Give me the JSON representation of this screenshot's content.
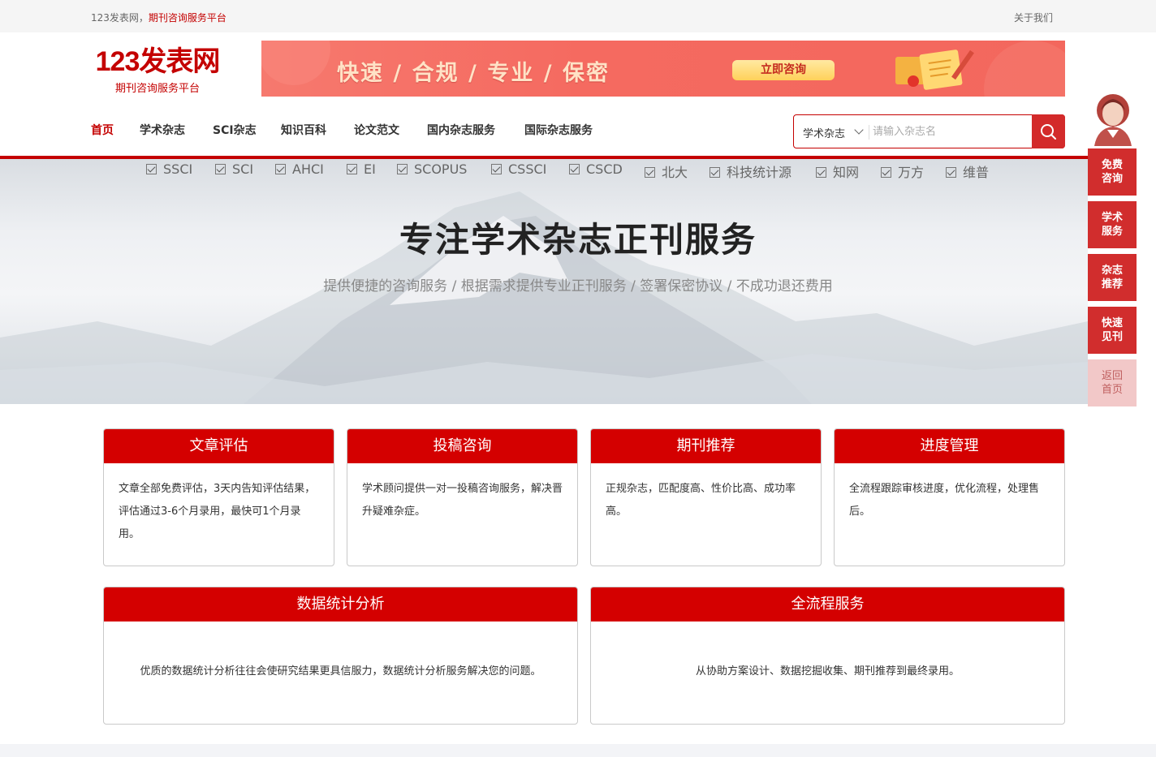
{
  "topbar": {
    "site": "123发表网，",
    "site_slogan": "期刊咨询服务平台",
    "about": "关于我们"
  },
  "logo": {
    "main": "123发表网",
    "sub": "期刊咨询服务平台"
  },
  "banner": {
    "slogan": "快速 / 合规 / 专业 / 保密",
    "button": "立即咨询"
  },
  "nav": [
    "首页",
    "学术杂志",
    "SCI杂志",
    "知识百科",
    "论文范文",
    "国内杂志服务",
    "国际杂志服务"
  ],
  "search": {
    "select": "学术杂志",
    "placeholder": "请输入杂志名",
    "icon": "search-icon"
  },
  "hero": {
    "title": "专注学术杂志正刊服务",
    "subtitle": "提供便捷的咨询服务 / 根据需求提供专业正刊服务 / 签署保密协议 / 不成功退还费用",
    "tags": [
      "SSCI",
      "SCI",
      "AHCI",
      "EI",
      "SCOPUS",
      "CSSCI",
      "CSCD",
      "北大",
      "科技统计源",
      "知网",
      "万方",
      "维普"
    ]
  },
  "cards": [
    {
      "title": "文章评估",
      "body": "文章全部免费评估，3天内告知评估结果，评估通过3-6个月录用，最快可1个月录用。"
    },
    {
      "title": "投稿咨询",
      "body": "学术顾问提供一对一投稿咨询服务，解决晋升疑难杂症。"
    },
    {
      "title": "期刊推荐",
      "body": "正规杂志，匹配度高、性价比高、成功率高。"
    },
    {
      "title": "进度管理",
      "body": "全流程跟踪审核进度，优化流程，处理售后。"
    }
  ],
  "wide_cards": [
    {
      "title": "数据统计分析",
      "body": "优质的数据统计分析往往会使研究结果更具信服力，数据统计分析服务解决您的问题。"
    },
    {
      "title": "全流程服务",
      "body": "从协助方案设计、数据挖掘收集、期刊推荐到最终录用。"
    }
  ],
  "side": {
    "buttons": [
      "免费咨询",
      "学术服务",
      "杂志推荐",
      "快速见刊"
    ],
    "home": "返回首页"
  },
  "colors": {
    "brand_red": "#c40000",
    "card_header": "#d40000",
    "side_button": "#d12d2d"
  }
}
